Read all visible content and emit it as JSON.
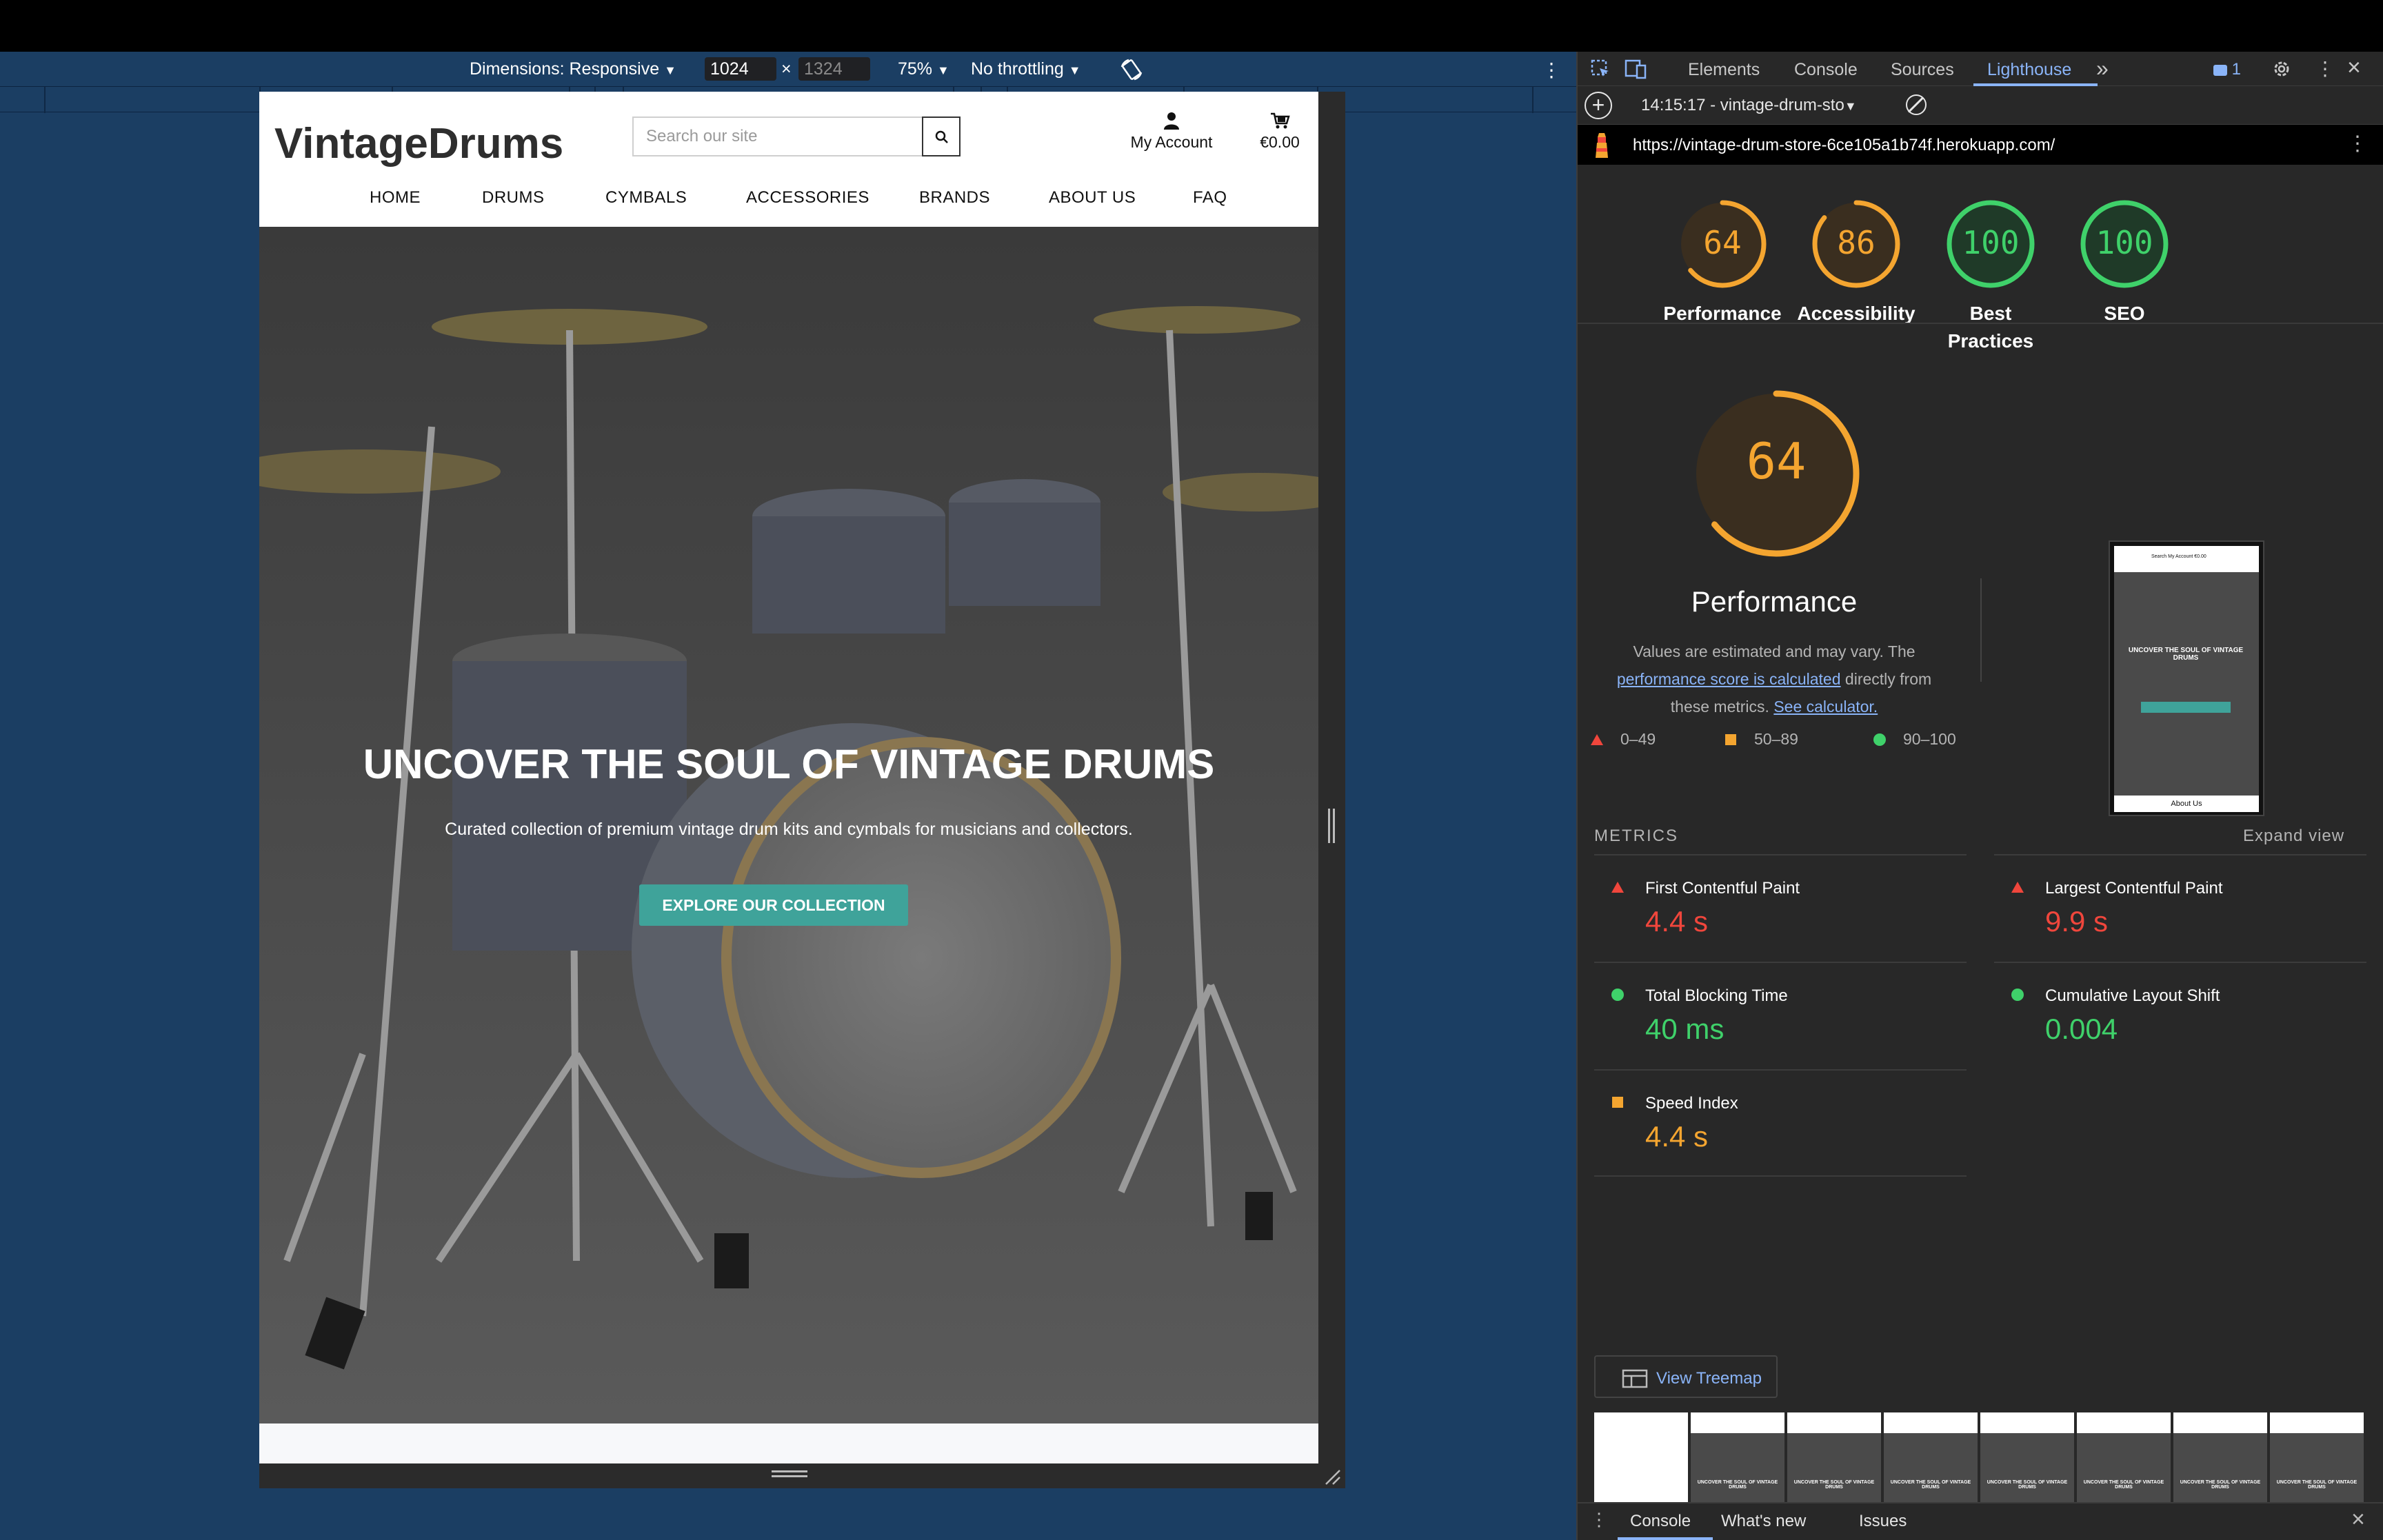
{
  "emulation": {
    "dimensions_label": "Dimensions: Responsive",
    "width_value": "1024",
    "height_value": "1324",
    "times": "×",
    "zoom": "75%",
    "throttling": "No throttling"
  },
  "site": {
    "logo": "VintageDrums",
    "search_placeholder": "Search our site",
    "account_label": "My Account",
    "cart_total": "€0.00",
    "nav": [
      "HOME",
      "DRUMS",
      "CYMBALS",
      "ACCESSORIES",
      "BRANDS",
      "ABOUT US",
      "FAQ"
    ],
    "hero_title": "UNCOVER THE SOUL OF VINTAGE DRUMS",
    "hero_subtitle": "Curated collection of premium vintage drum kits and cymbals for musicians and collectors.",
    "hero_button": "EXPLORE OUR COLLECTION"
  },
  "devtools": {
    "tabs": [
      "Elements",
      "Console",
      "Sources",
      "Lighthouse"
    ],
    "active_tab": "Lighthouse",
    "more": "»",
    "issues_count": "1",
    "report_select": "14:15:17 - vintage-drum-sto",
    "url": "https://vintage-drum-store-6ce105a1b74f.herokuapp.com/",
    "scores": [
      {
        "label": "Performance",
        "value": 64,
        "color": "#f4a530"
      },
      {
        "label": "Accessibility",
        "value": 86,
        "color": "#f4a530"
      },
      {
        "label": "Best Practices",
        "value": 100,
        "color": "#3fd16a"
      },
      {
        "label": "SEO",
        "value": 100,
        "color": "#3fd16a"
      }
    ],
    "perf_big_value": "64",
    "perf_big_label": "Performance",
    "perf_note_1": "Values are estimated and may vary. The",
    "perf_note_link": "performance score is calculated",
    "perf_note_2": "directly from",
    "perf_note_3": "these metrics.",
    "perf_note_link2": "See calculator.",
    "legend": [
      {
        "range": "0–49",
        "color": "#f0463c",
        "shape": "triangle"
      },
      {
        "range": "50–89",
        "color": "#f4a530",
        "shape": "square"
      },
      {
        "range": "90–100",
        "color": "#3fd16a",
        "shape": "circle"
      }
    ],
    "metrics_title": "METRICS",
    "expand_view": "Expand view",
    "metrics": [
      {
        "name": "First Contentful Paint",
        "value": "4.4 s",
        "color": "#f0463c",
        "shape": "triangle"
      },
      {
        "name": "Largest Contentful Paint",
        "value": "9.9 s",
        "color": "#f0463c",
        "shape": "triangle"
      },
      {
        "name": "Total Blocking Time",
        "value": "40 ms",
        "color": "#3fd16a",
        "shape": "circle"
      },
      {
        "name": "Cumulative Layout Shift",
        "value": "0.004",
        "color": "#3fd16a",
        "shape": "circle"
      },
      {
        "name": "Speed Index",
        "value": "4.4 s",
        "color": "#f4a530",
        "shape": "square"
      }
    ],
    "view_treemap": "View Treemap",
    "thumb": {
      "nav": "Search  My Account  €0.00",
      "title": "UNCOVER THE SOUL OF VINTAGE DRUMS",
      "about": "About Us"
    },
    "drawer_tabs": [
      "Console",
      "What's new",
      "Issues"
    ]
  }
}
